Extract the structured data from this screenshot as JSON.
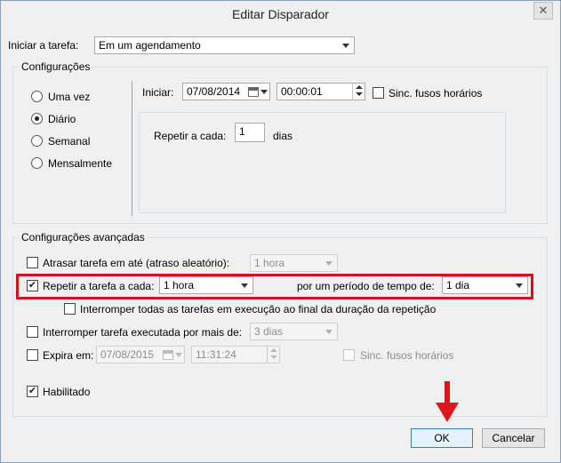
{
  "window": {
    "title": "Editar Disparador",
    "close_glyph": "✕"
  },
  "start_task": {
    "label": "Iniciar a tarefa:",
    "value": "Em um agendamento"
  },
  "settings": {
    "group_title": "Configurações",
    "frequency_options": [
      {
        "label": "Uma vez",
        "selected": false
      },
      {
        "label": "Diário",
        "selected": true
      },
      {
        "label": "Semanal",
        "selected": false
      },
      {
        "label": "Mensalmente",
        "selected": false
      }
    ],
    "start_label": "Iniciar:",
    "start_date": "07/08/2014",
    "start_time": "00:00:01",
    "sync_timezones_label": "Sinc. fusos horários",
    "sync_timezones_checked": false,
    "repeat_every_label": "Repetir a cada:",
    "repeat_every_value": "1",
    "repeat_every_unit": "dias"
  },
  "advanced": {
    "group_title": "Configurações avançadas",
    "delay_label": "Atrasar tarefa em até (atraso aleatório):",
    "delay_checked": false,
    "delay_value": "1 hora",
    "repeat_label": "Repetir a tarefa a cada:",
    "repeat_checked": true,
    "repeat_value": "1 hora",
    "duration_label": "por um período de tempo de:",
    "duration_value": "1 dia",
    "stop_all_label": "Interromper todas as tarefas em execução ao final da duração da repetição",
    "stop_all_checked": false,
    "stop_longer_label": "Interromper tarefa executada por mais de:",
    "stop_longer_checked": false,
    "stop_longer_value": "3 dias",
    "expires_label": "Expira em:",
    "expires_checked": false,
    "expires_date": "07/08/2015",
    "expires_time": "11:31:24",
    "expires_sync_label": "Sinc. fusos horários",
    "enabled_label": "Habilitado",
    "enabled_checked": true
  },
  "buttons": {
    "ok": "OK",
    "cancel": "Cancelar"
  },
  "annotations": {
    "highlight_color": "#d0141d",
    "arrow_color": "#e0141c"
  },
  "icons": {
    "check_glyph": "✔",
    "calendar": "calendar-icon",
    "arrow": "red-down-arrow-icon"
  }
}
